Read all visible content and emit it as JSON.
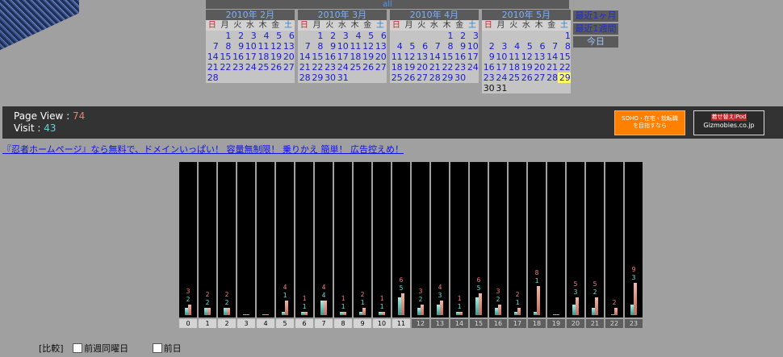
{
  "calendar": {
    "all_label": "all",
    "weekdays": [
      "日",
      "月",
      "火",
      "水",
      "木",
      "金",
      "土"
    ],
    "months": [
      {
        "title": "2010年 2月",
        "first_weekday": 1,
        "days": 28,
        "today": null
      },
      {
        "title": "2010年 3月",
        "first_weekday": 1,
        "days": 31,
        "today": null
      },
      {
        "title": "2010年 4月",
        "first_weekday": 4,
        "days": 30,
        "today": null
      },
      {
        "title": "2010年 5月",
        "first_weekday": 6,
        "days": 31,
        "today": 29
      }
    ],
    "range_links": [
      "最近1ヶ月",
      "最近1週間",
      "今日"
    ]
  },
  "stats": {
    "page_view_label": "Page View : ",
    "page_view_value": "74",
    "visit_label": "Visit : ",
    "visit_value": "43"
  },
  "ads": {
    "soho_line1": "SOHO・在宅・就転職",
    "soho_line2": "を目指すなら",
    "gizmo_ribbon": "着せ替えiPod",
    "gizmo_domain": "Gizmobies.co.jp"
  },
  "promo_text": "『忍者ホームページ』なら無料で、ドメインいっぱい！ 容量無制限！ 乗りかえ 簡単！ 広告控えめ！",
  "colors": {
    "page_view": "#ff7a7a",
    "visit": "#66e0d8",
    "today_highlight": "#ffff66"
  },
  "chart_data": {
    "type": "bar",
    "categories": [
      "0",
      "1",
      "2",
      "3",
      "4",
      "5",
      "6",
      "7",
      "8",
      "9",
      "10",
      "11",
      "12",
      "13",
      "14",
      "15",
      "16",
      "17",
      "18",
      "19",
      "20",
      "21",
      "22",
      "23"
    ],
    "series": [
      {
        "name": "Page View",
        "values": [
          3,
          2,
          2,
          0,
          0,
          4,
          1,
          4,
          1,
          2,
          1,
          6,
          3,
          4,
          1,
          6,
          3,
          2,
          8,
          0,
          5,
          5,
          2,
          9
        ]
      },
      {
        "name": "Visit",
        "values": [
          2,
          2,
          2,
          0,
          0,
          1,
          1,
          4,
          1,
          1,
          1,
          5,
          2,
          3,
          1,
          5,
          2,
          1,
          1,
          0,
          3,
          2,
          0,
          3
        ]
      }
    ],
    "printed_pv": [
      "3",
      "2",
      "2",
      "",
      "",
      "4",
      "1",
      "4",
      "1",
      "2",
      "1",
      "6",
      "3",
      "4",
      "1",
      "6",
      "3",
      "2",
      "8",
      "",
      "5",
      "5",
      "2",
      "9"
    ],
    "printed_visit": [
      "2",
      "2",
      "2",
      "",
      "",
      "1",
      "1",
      "4",
      "1",
      "1",
      "1",
      "5",
      "2",
      "3",
      "1",
      "5",
      "2",
      "1",
      "1",
      "",
      "3",
      "2",
      "",
      "3"
    ],
    "shaded_hours": [
      12,
      13,
      14,
      15,
      16,
      17,
      18,
      19,
      20,
      21,
      22,
      23
    ],
    "ylim": [
      0,
      40
    ]
  },
  "compare": {
    "label": "[比較]",
    "option1": "前週同曜日",
    "option2": "前日"
  }
}
